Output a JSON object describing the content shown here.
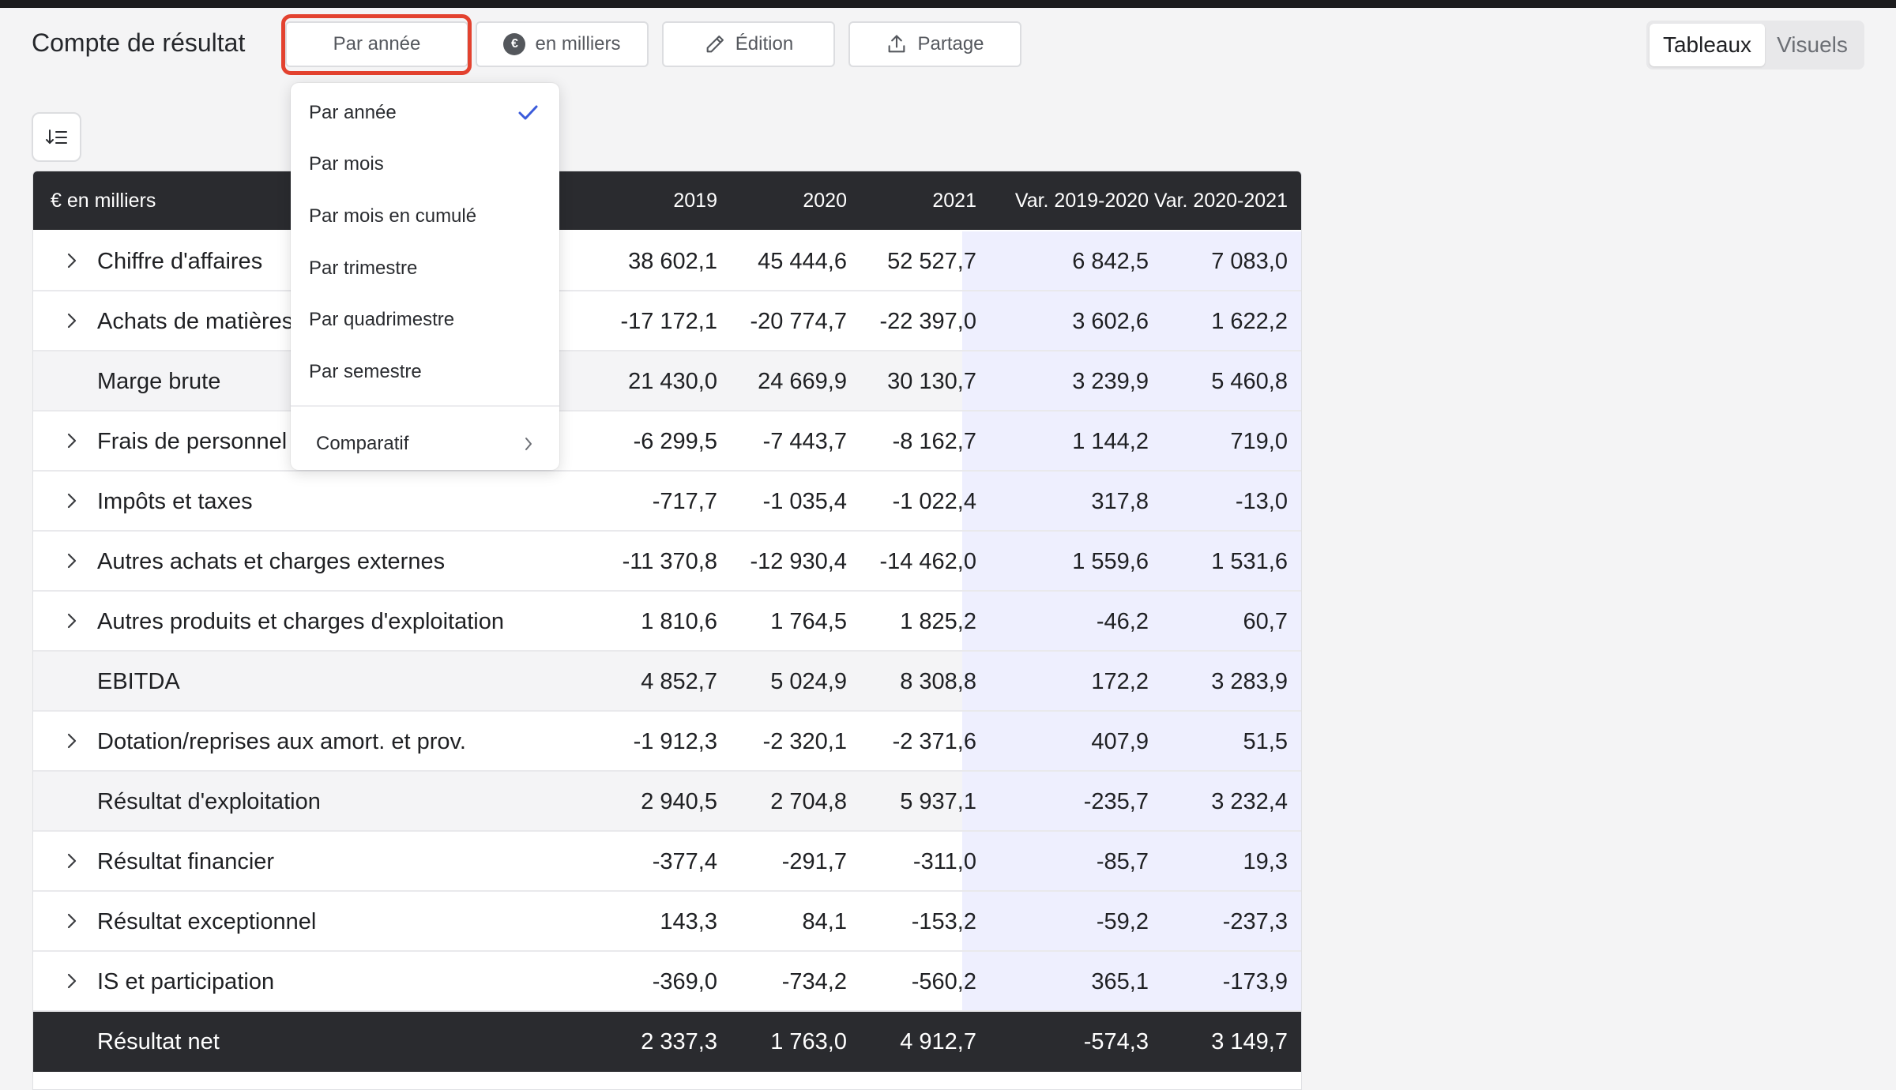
{
  "toolbar": {
    "title": "Compte de résultat",
    "period_button": "Par année",
    "unit_button": "en milliers",
    "unit_symbol": "€",
    "edit_button": "Édition",
    "share_button": "Partage",
    "view_tabs": {
      "active": "Tableaux",
      "inactive": "Visuels"
    }
  },
  "period_menu": {
    "items": [
      "Par année",
      "Par mois",
      "Par mois en cumulé",
      "Par trimestre",
      "Par quadrimestre",
      "Par semestre"
    ],
    "selected": "Par année",
    "submenu_label": "Comparatif"
  },
  "table": {
    "headers": {
      "label": "€ en milliers",
      "y2019": "2019",
      "y2020": "2020",
      "y2021": "2021",
      "var1": "Var. 2019-2020",
      "var2": "Var. 2020-2021"
    },
    "rows": [
      {
        "label": "Chiffre d'affaires",
        "type": "expandable",
        "y2019": "38 602,1",
        "y2020": "45 444,6",
        "y2021": "52 527,7",
        "var1": "6 842,5",
        "var2": "7 083,0"
      },
      {
        "label": "Achats de matières",
        "type": "expandable",
        "y2019": "-17 172,1",
        "y2020": "-20 774,7",
        "y2021": "-22 397,0",
        "var1": "3 602,6",
        "var2": "1 622,2"
      },
      {
        "label": "Marge brute",
        "type": "subtotal",
        "y2019": "21 430,0",
        "y2020": "24 669,9",
        "y2021": "30 130,7",
        "var1": "3 239,9",
        "var2": "5 460,8"
      },
      {
        "label": "Frais de personnel",
        "type": "expandable",
        "y2019": "-6 299,5",
        "y2020": "-7 443,7",
        "y2021": "-8 162,7",
        "var1": "1 144,2",
        "var2": "719,0"
      },
      {
        "label": "Impôts et taxes",
        "type": "expandable",
        "y2019": "-717,7",
        "y2020": "-1 035,4",
        "y2021": "-1 022,4",
        "var1": "317,8",
        "var2": "-13,0"
      },
      {
        "label": "Autres achats et charges externes",
        "type": "expandable",
        "y2019": "-11 370,8",
        "y2020": "-12 930,4",
        "y2021": "-14 462,0",
        "var1": "1 559,6",
        "var2": "1 531,6"
      },
      {
        "label": "Autres produits et charges d'exploitation",
        "type": "expandable",
        "y2019": "1 810,6",
        "y2020": "1 764,5",
        "y2021": "1 825,2",
        "var1": "-46,2",
        "var2": "60,7"
      },
      {
        "label": "EBITDA",
        "type": "subtotal",
        "y2019": "4 852,7",
        "y2020": "5 024,9",
        "y2021": "8 308,8",
        "var1": "172,2",
        "var2": "3 283,9"
      },
      {
        "label": "Dotation/reprises aux amort. et prov.",
        "type": "expandable",
        "y2019": "-1 912,3",
        "y2020": "-2 320,1",
        "y2021": "-2 371,6",
        "var1": "407,9",
        "var2": "51,5"
      },
      {
        "label": "Résultat d'exploitation",
        "type": "subtotal",
        "y2019": "2 940,5",
        "y2020": "2 704,8",
        "y2021": "5 937,1",
        "var1": "-235,7",
        "var2": "3 232,4"
      },
      {
        "label": "Résultat financier",
        "type": "expandable",
        "y2019": "-377,4",
        "y2020": "-291,7",
        "y2021": "-311,0",
        "var1": "-85,7",
        "var2": "19,3"
      },
      {
        "label": "Résultat exceptionnel",
        "type": "expandable",
        "y2019": "143,3",
        "y2020": "84,1",
        "y2021": "-153,2",
        "var1": "-59,2",
        "var2": "-237,3"
      },
      {
        "label": "IS et participation",
        "type": "expandable",
        "y2019": "-369,0",
        "y2020": "-734,2",
        "y2021": "-560,2",
        "var1": "365,1",
        "var2": "-173,9"
      },
      {
        "label": "Résultat net",
        "type": "total",
        "y2019": "2 337,3",
        "y2020": "1 763,0",
        "y2021": "4 912,7",
        "var1": "-574,3",
        "var2": "3 149,7"
      }
    ]
  },
  "colors": {
    "highlight": "#e3422f",
    "check": "#3b5bdb",
    "variance_bg": "#eeeffe",
    "header_bg": "#2a2b2f"
  }
}
